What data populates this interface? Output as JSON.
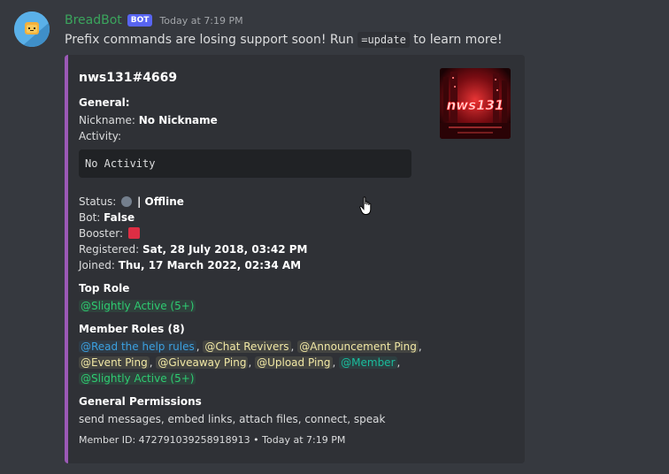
{
  "author": {
    "name": "BreadBot",
    "tag": "BOT",
    "timestamp": "Today at 7:19 PM",
    "avatar_icon": "bread-bot-avatar"
  },
  "message": {
    "text_before": "Prefix commands are losing support soon! Run ",
    "code": "=update",
    "text_after": " to learn more!"
  },
  "embed": {
    "accent_color": "#9b59b6",
    "title": "nws131#4669",
    "thumbnail_text": "nws131",
    "general": {
      "label": "General:",
      "nickname_label": "Nickname:",
      "nickname_value": "No Nickname",
      "activity_label": "Activity:",
      "activity_value": "No Activity"
    },
    "status": {
      "label": "Status:",
      "value": "| Offline",
      "icon": "offline-status-icon"
    },
    "bot": {
      "label": "Bot:",
      "value": "False"
    },
    "booster": {
      "label": "Booster:",
      "icon": "red-square-icon"
    },
    "registered": {
      "label": "Registered:",
      "value": "Sat, 28 July 2018, 03:42 PM"
    },
    "joined": {
      "label": "Joined:",
      "value": "Thu, 17 March 2022, 02:34 AM"
    },
    "top_role": {
      "label": "Top Role",
      "value": "@Slightly Active (5+)"
    },
    "member_roles": {
      "label": "Member Roles (8)",
      "roles": [
        "@Read the help rules",
        "@Chat Revivers",
        "@Announcement Ping",
        "@Event Ping",
        "@Giveaway Ping",
        "@Upload Ping",
        "@Member",
        "@Slightly Active (5+)"
      ]
    },
    "permissions": {
      "label": "General Permissions",
      "value": "send messages, embed links, attach files, connect, speak"
    },
    "footer": {
      "member_id": "Member ID: 472791039258918913",
      "separator": "•",
      "timestamp": "Today at 7:19 PM"
    }
  }
}
